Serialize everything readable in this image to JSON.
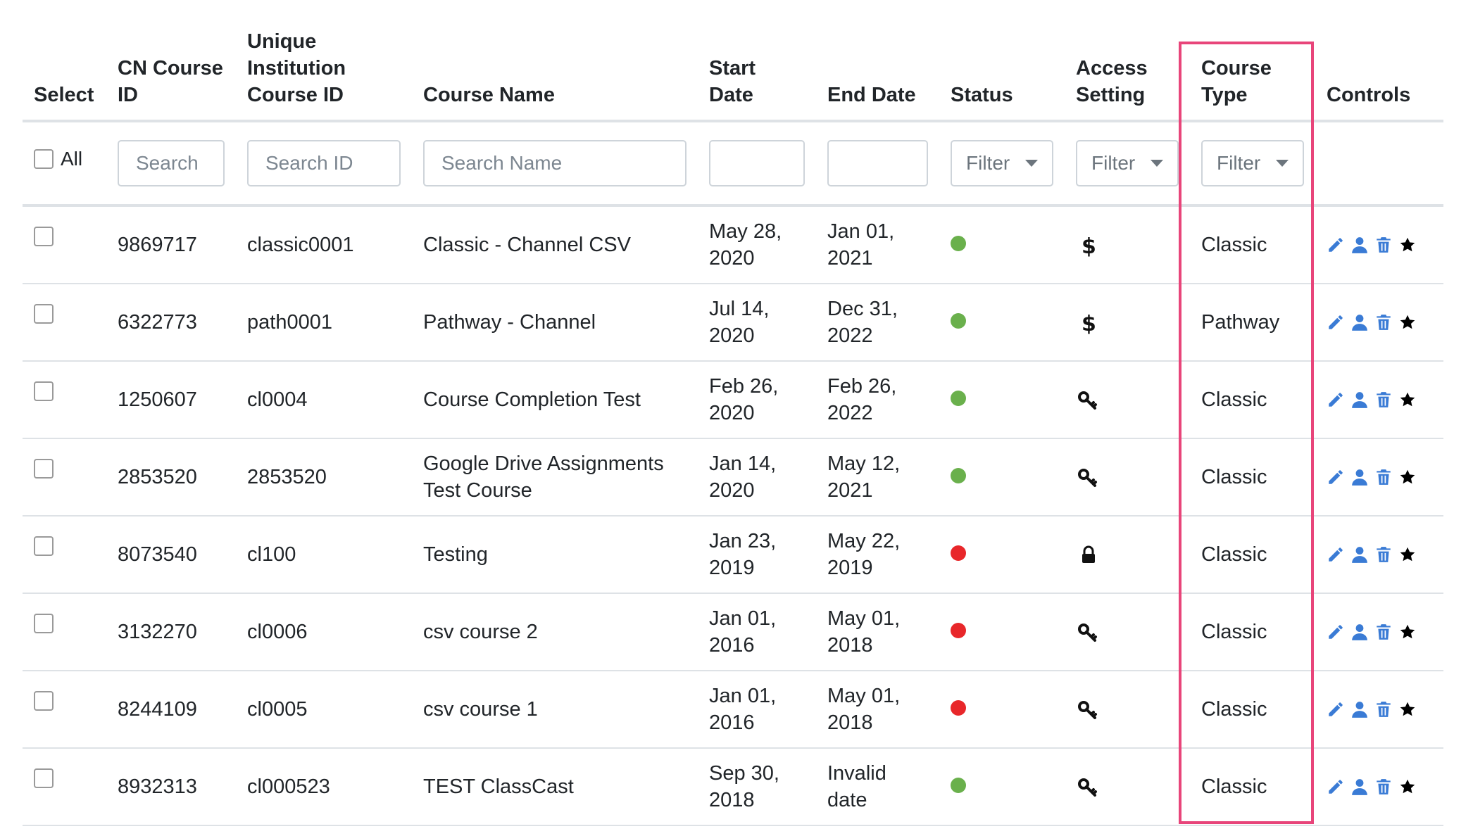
{
  "columns": {
    "select": "Select",
    "cn_course_id": "CN Course ID",
    "unique_id": "Unique Institution Course ID",
    "course_name": "Course Name",
    "start_date": "Start Date",
    "end_date": "End Date",
    "status": "Status",
    "access": "Access Setting",
    "course_type": "Course Type",
    "controls": "Controls"
  },
  "filters": {
    "all_label": "All",
    "search_cn_placeholder": "Search",
    "search_id_placeholder": "Search ID",
    "search_name_placeholder": "Search Name",
    "status_filter": "Filter",
    "access_filter": "Filter",
    "type_filter": "Filter"
  },
  "colors": {
    "active": "#6ab04c",
    "inactive": "#e8272a",
    "icon_blue": "#3a7bd5",
    "highlight": "#e8457a"
  },
  "rows": [
    {
      "cn_id": "9869717",
      "inst_id": "classic0001",
      "name": "Classic - Channel CSV",
      "start": "May 28, 2020",
      "end": "Jan 01, 2021",
      "status": "active",
      "access": "dollar-icon",
      "type": "Classic",
      "favorite": true
    },
    {
      "cn_id": "6322773",
      "inst_id": "path0001",
      "name": "Pathway - Channel",
      "start": "Jul 14, 2020",
      "end": "Dec 31, 2022",
      "status": "active",
      "access": "dollar-icon",
      "type": "Pathway",
      "favorite": true
    },
    {
      "cn_id": "1250607",
      "inst_id": "cl0004",
      "name": "Course Completion Test",
      "start": "Feb 26, 2020",
      "end": "Feb 26, 2022",
      "status": "active",
      "access": "key-icon",
      "type": "Classic",
      "favorite": false
    },
    {
      "cn_id": "2853520",
      "inst_id": "2853520",
      "name": "Google Drive Assignments Test Course",
      "start": "Jan 14, 2020",
      "end": "May 12, 2021",
      "status": "active",
      "access": "key-icon",
      "type": "Classic",
      "favorite": false
    },
    {
      "cn_id": "8073540",
      "inst_id": "cl100",
      "name": "Testing",
      "start": "Jan 23, 2019",
      "end": "May 22, 2019",
      "status": "inactive",
      "access": "lock-icon",
      "type": "Classic",
      "favorite": false
    },
    {
      "cn_id": "3132270",
      "inst_id": "cl0006",
      "name": "csv course 2",
      "start": "Jan 01, 2016",
      "end": "May 01, 2018",
      "status": "inactive",
      "access": "key-icon",
      "type": "Classic",
      "favorite": false
    },
    {
      "cn_id": "8244109",
      "inst_id": "cl0005",
      "name": "csv course 1",
      "start": "Jan 01, 2016",
      "end": "May 01, 2018",
      "status": "inactive",
      "access": "key-icon",
      "type": "Classic",
      "favorite": false
    },
    {
      "cn_id": "8932313",
      "inst_id": "cl000523",
      "name": "TEST ClassCast",
      "start": "Sep 30, 2018",
      "end": "Invalid date",
      "status": "active",
      "access": "key-icon",
      "type": "Classic",
      "favorite": false
    }
  ]
}
